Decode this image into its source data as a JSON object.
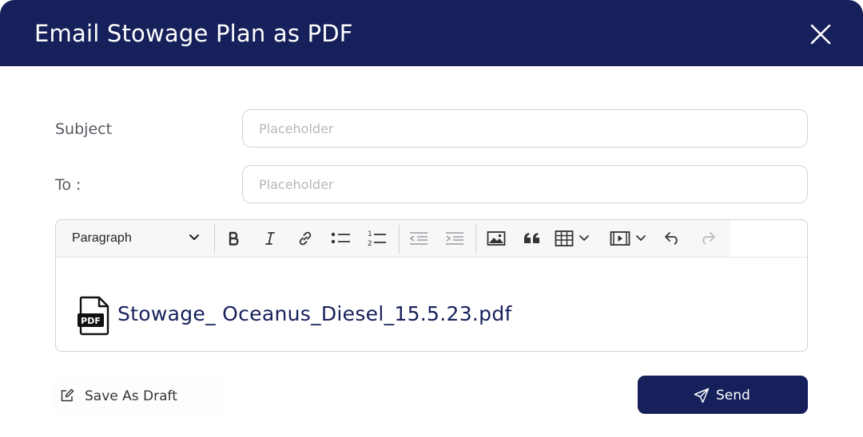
{
  "dialog": {
    "title": "Email Stowage Plan as PDF",
    "close_icon": "close-icon"
  },
  "form": {
    "subject": {
      "label": "Subject",
      "placeholder": "Placeholder",
      "value": ""
    },
    "to": {
      "label": "To :",
      "placeholder": "Placeholder",
      "value": ""
    }
  },
  "editor": {
    "block_format": "Paragraph",
    "toolbar": [
      "bold-icon",
      "italic-icon",
      "link-icon",
      "bulleted-list-icon",
      "numbered-list-icon",
      "outdent-icon",
      "indent-icon",
      "image-icon",
      "quote-icon",
      "table-icon",
      "media-icon",
      "undo-icon",
      "redo-icon"
    ],
    "numbered_list_glyphs": {
      "one": "1",
      "two": "2"
    },
    "attachment": {
      "icon": "pdf-file-icon",
      "badge": "PDF",
      "filename": "Stowage_ Oceanus_Diesel_15.5.23.pdf"
    }
  },
  "footer": {
    "draft_label": "Save As Draft",
    "send_label": "Send"
  },
  "colors": {
    "brand": "#16205a",
    "border": "#cfd1d4",
    "placeholder": "#b5b8bc",
    "label": "#555a60"
  }
}
